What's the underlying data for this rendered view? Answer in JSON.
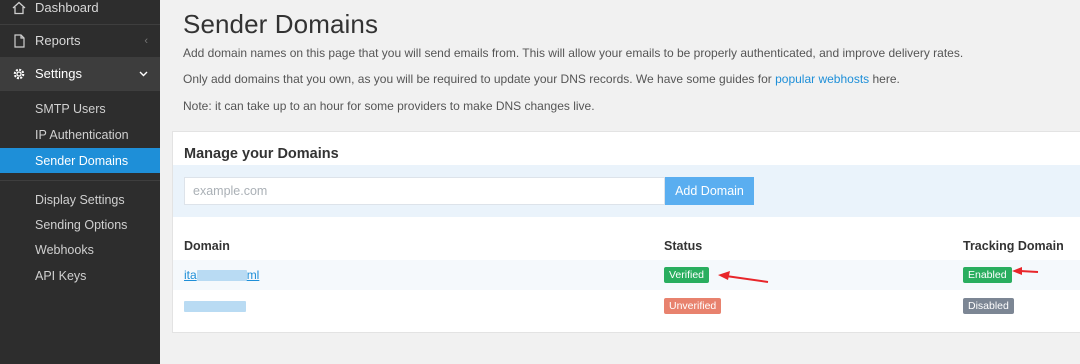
{
  "sidebar": {
    "dashboard": "Dashboard",
    "reports": "Reports",
    "settings": "Settings",
    "sub_items": [
      "SMTP Users",
      "IP Authentication",
      "Sender Domains",
      "Display Settings",
      "Sending Options",
      "Webhooks",
      "API Keys"
    ]
  },
  "page": {
    "title": "Sender Domains",
    "desc1": "Add domain names on this page that you will send emails from. This will allow your emails to be properly authenticated, and improve delivery rates.",
    "desc2_before": "Only add domains that you own, as you will be required to update your DNS records. We have some guides for ",
    "desc2_link": "popular webhosts",
    "desc2_after": " here.",
    "desc3": "Note: it can take up to an hour for some providers to make DNS changes live."
  },
  "panel": {
    "title": "Manage your Domains",
    "input_placeholder": "example.com",
    "add_button": "Add Domain",
    "columns": [
      "Domain",
      "Status",
      "Tracking Domain"
    ],
    "rows": [
      {
        "domain_prefix": "ita",
        "domain_suffix": "ml",
        "status": "Verified",
        "tracking": "Enabled"
      },
      {
        "domain_prefix": "",
        "domain_suffix": "",
        "status": "Unverified",
        "tracking": "Disabled"
      }
    ]
  },
  "colors": {
    "accent": "#1e8fd8",
    "verified": "#2aae5f",
    "unverified": "#e8826e",
    "disabled": "#7c8694",
    "sidebar_bg": "#2d2d2d",
    "annotation_arrow": "#e8262a"
  },
  "icons": {
    "dashboard": "home-icon",
    "reports": "document-icon",
    "settings": "gear-icon"
  }
}
